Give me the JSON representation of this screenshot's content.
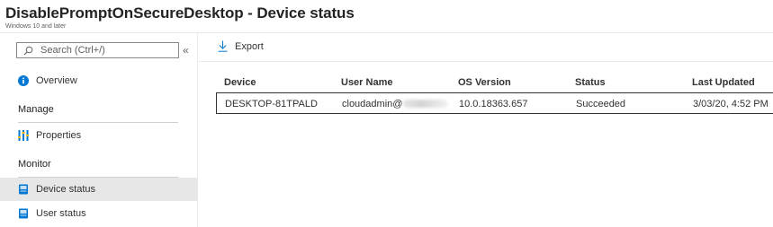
{
  "header": {
    "title": "DisablePromptOnSecureDesktop - Device status",
    "subtitle": "Windows 10 and later"
  },
  "sidebar": {
    "search_placeholder": "Search (Ctrl+/)",
    "collapse_label": "«",
    "overview_label": "Overview",
    "manage_label": "Manage",
    "properties_label": "Properties",
    "monitor_label": "Monitor",
    "device_status_label": "Device status",
    "user_status_label": "User status"
  },
  "toolbar": {
    "export_label": "Export"
  },
  "table": {
    "headers": [
      "Device",
      "User Name",
      "OS Version",
      "Status",
      "Last Updated"
    ],
    "rows": [
      [
        "DESKTOP-81TPALD",
        "cloudadmin@",
        "10.0.18363.657",
        "Succeeded",
        "3/03/20, 4:52 PM"
      ]
    ]
  },
  "colors": {
    "accent": "#0078d4",
    "selected_bg": "#e7e7e7",
    "divider": "#edebe9"
  },
  "icons": {
    "search": "search-icon",
    "overview": "info-icon",
    "properties": "properties-icon",
    "device_status": "device-status-icon",
    "user_status": "user-status-icon",
    "export": "download-arrow-icon"
  }
}
